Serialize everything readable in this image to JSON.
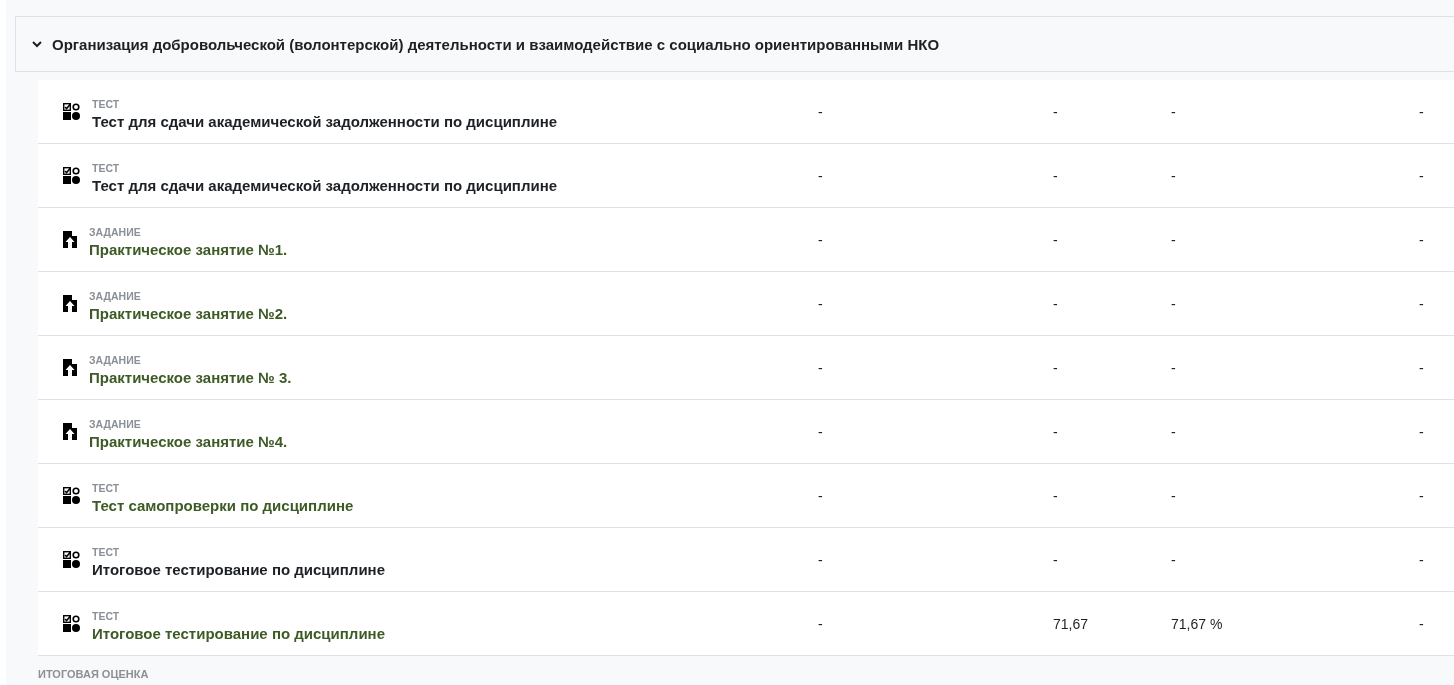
{
  "category": {
    "title": "Организация добровольческой (волонтерской) деятельности и взаимодействие с социально ориентированными НКО",
    "expanded": true
  },
  "rows": [
    {
      "kind": "quiz",
      "type_label": "ТЕСТ",
      "title": "Тест для сдачи академической задолженности по дисциплине",
      "link": false,
      "cells": [
        "-",
        "-",
        "-",
        "-"
      ]
    },
    {
      "kind": "quiz",
      "type_label": "ТЕСТ",
      "title": "Тест для сдачи академической задолженности по дисциплине",
      "link": false,
      "cells": [
        "-",
        "-",
        "-",
        "-"
      ]
    },
    {
      "kind": "assign",
      "type_label": "ЗАДАНИЕ",
      "title": "Практическое занятие №1.",
      "link": true,
      "cells": [
        "-",
        "-",
        "-",
        "-"
      ]
    },
    {
      "kind": "assign",
      "type_label": "ЗАДАНИЕ",
      "title": "Практическое занятие №2.",
      "link": true,
      "cells": [
        "-",
        "-",
        "-",
        "-"
      ]
    },
    {
      "kind": "assign",
      "type_label": "ЗАДАНИЕ",
      "title": "Практическое занятие № 3.",
      "link": true,
      "cells": [
        "-",
        "-",
        "-",
        "-"
      ]
    },
    {
      "kind": "assign",
      "type_label": "ЗАДАНИЕ",
      "title": "Практическое занятие №4.",
      "link": true,
      "cells": [
        "-",
        "-",
        "-",
        "-"
      ]
    },
    {
      "kind": "quiz",
      "type_label": "ТЕСТ",
      "title": "Тест самопроверки по дисциплине",
      "link": true,
      "cells": [
        "-",
        "-",
        "-",
        "-"
      ]
    },
    {
      "kind": "quiz",
      "type_label": "ТЕСТ",
      "title": "Итоговое тестирование по дисциплине",
      "link": false,
      "cells": [
        "-",
        "-",
        "-",
        "-"
      ]
    },
    {
      "kind": "quiz",
      "type_label": "ТЕСТ",
      "title": "Итоговое тестирование по дисциплине",
      "link": true,
      "cells": [
        "-",
        "71,67",
        "71,67 %",
        "-"
      ]
    }
  ],
  "total": {
    "type_label": "ИТОГОВАЯ ОЦЕНКА"
  }
}
